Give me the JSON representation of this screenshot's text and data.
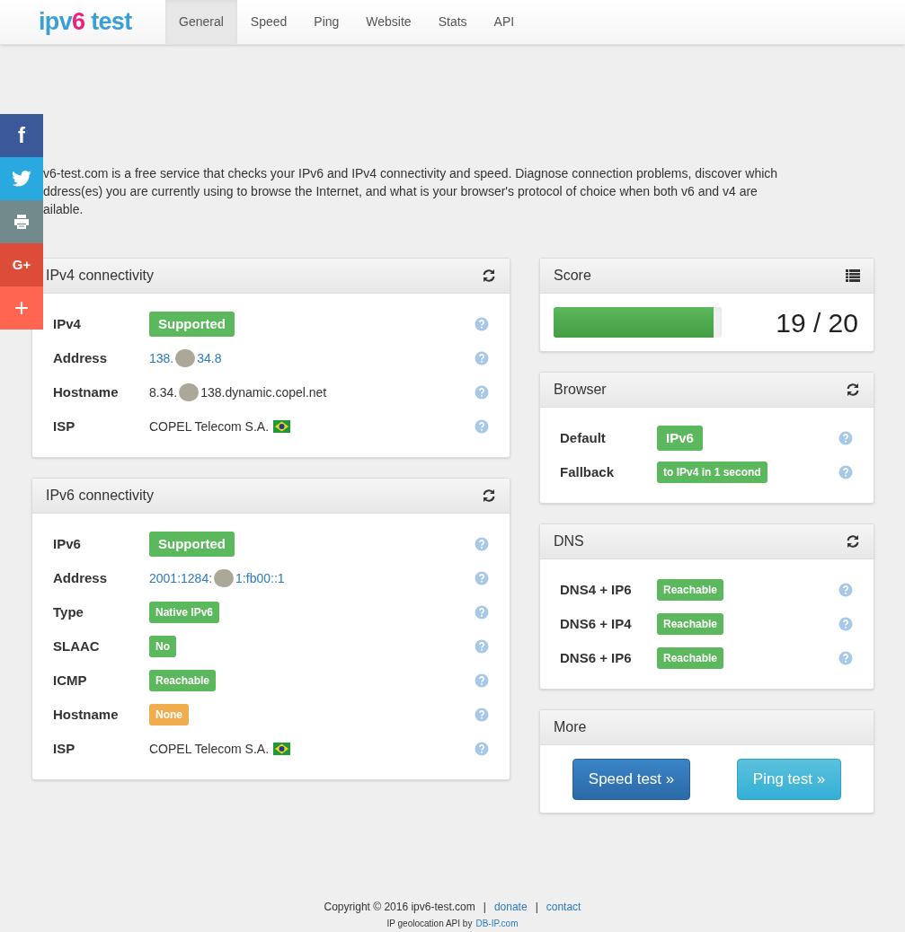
{
  "logo": {
    "parts": [
      "ipv",
      "6",
      " test"
    ]
  },
  "nav": [
    {
      "label": "General",
      "selected": true
    },
    {
      "label": "Speed",
      "selected": false
    },
    {
      "label": "Ping",
      "selected": false
    },
    {
      "label": "Website",
      "selected": false
    },
    {
      "label": "Stats",
      "selected": false
    },
    {
      "label": "API",
      "selected": false
    }
  ],
  "share_bar": [
    {
      "kind": "facebook",
      "glyph": "f"
    },
    {
      "kind": "twitter"
    },
    {
      "kind": "print"
    },
    {
      "kind": "googleplus",
      "glyph": "G+"
    },
    {
      "kind": "more",
      "glyph": "+"
    }
  ],
  "intro_lines": [
    "v6-test.com is a free service that checks your IPv6 and IPv4 connectivity and speed. Diagnose connection problems, discover which",
    "ddress(es) you are currently using to browse the Internet, and what is your browser's protocol of choice when both v6 and v4 are",
    "ailable."
  ],
  "left_panels": [
    {
      "title": "IPv4 connectivity",
      "rows": [
        {
          "label": "IPv4",
          "kind": "badge-large",
          "value": "Supported",
          "color": "#5cb85c"
        },
        {
          "label": "Address",
          "kind": "redacted-link",
          "parts": [
            "138.",
            "34.8"
          ]
        },
        {
          "label": "Hostname",
          "kind": "redacted-text",
          "parts": [
            "8.34.",
            "138.dynamic.copel.net"
          ]
        },
        {
          "label": "ISP",
          "kind": "isp",
          "value": "COPEL Telecom S.A."
        }
      ]
    },
    {
      "title": "IPv6 connectivity",
      "rows": [
        {
          "label": "IPv6",
          "kind": "badge-large",
          "value": "Supported",
          "color": "#5cb85c"
        },
        {
          "label": "Address",
          "kind": "redacted-link",
          "parts": [
            "2001:1284:",
            "1:fb00::1"
          ]
        },
        {
          "label": "Type",
          "kind": "badge",
          "value": "Native IPv6",
          "color": "#5cb85c"
        },
        {
          "label": "SLAAC",
          "kind": "badge",
          "value": "No",
          "color": "#5cb85c"
        },
        {
          "label": "ICMP",
          "kind": "badge",
          "value": "Reachable",
          "color": "#5cb85c"
        },
        {
          "label": "Hostname",
          "kind": "badge",
          "value": "None",
          "color": "#f0ad4e"
        },
        {
          "label": "ISP",
          "kind": "isp",
          "value": "COPEL Telecom S.A."
        }
      ]
    }
  ],
  "score": {
    "title": "Score",
    "level": 0.95,
    "value": "19 / 20"
  },
  "browser": {
    "title": "Browser",
    "rows": [
      {
        "label": "Default",
        "kind": "badge-large",
        "value": "IPv6",
        "color": "#5cb85c"
      },
      {
        "label": "Fallback",
        "kind": "badge",
        "value": "to IPv4 in 1 second",
        "color": "#5cb85c"
      }
    ]
  },
  "dns": {
    "title": "DNS",
    "rows": [
      {
        "label": "DNS4 + IP6",
        "kind": "badge",
        "value": "Reachable",
        "color": "#5cb85c"
      },
      {
        "label": "DNS6 + IP4",
        "kind": "badge",
        "value": "Reachable",
        "color": "#5cb85c"
      },
      {
        "label": "DNS6 + IP6",
        "kind": "badge",
        "value": "Reachable",
        "color": "#5cb85c"
      }
    ]
  },
  "more": {
    "title": "More",
    "buttons": [
      "Speed test »",
      "Ping test »"
    ]
  },
  "footer": {
    "copyright": "Copyright © 2016 ipv6-test.com",
    "sep1": "|",
    "donate": "donate",
    "sep2": "|",
    "contact": "contact",
    "geo": "IP geolocation API by",
    "geo_link": "DB-IP.com"
  }
}
